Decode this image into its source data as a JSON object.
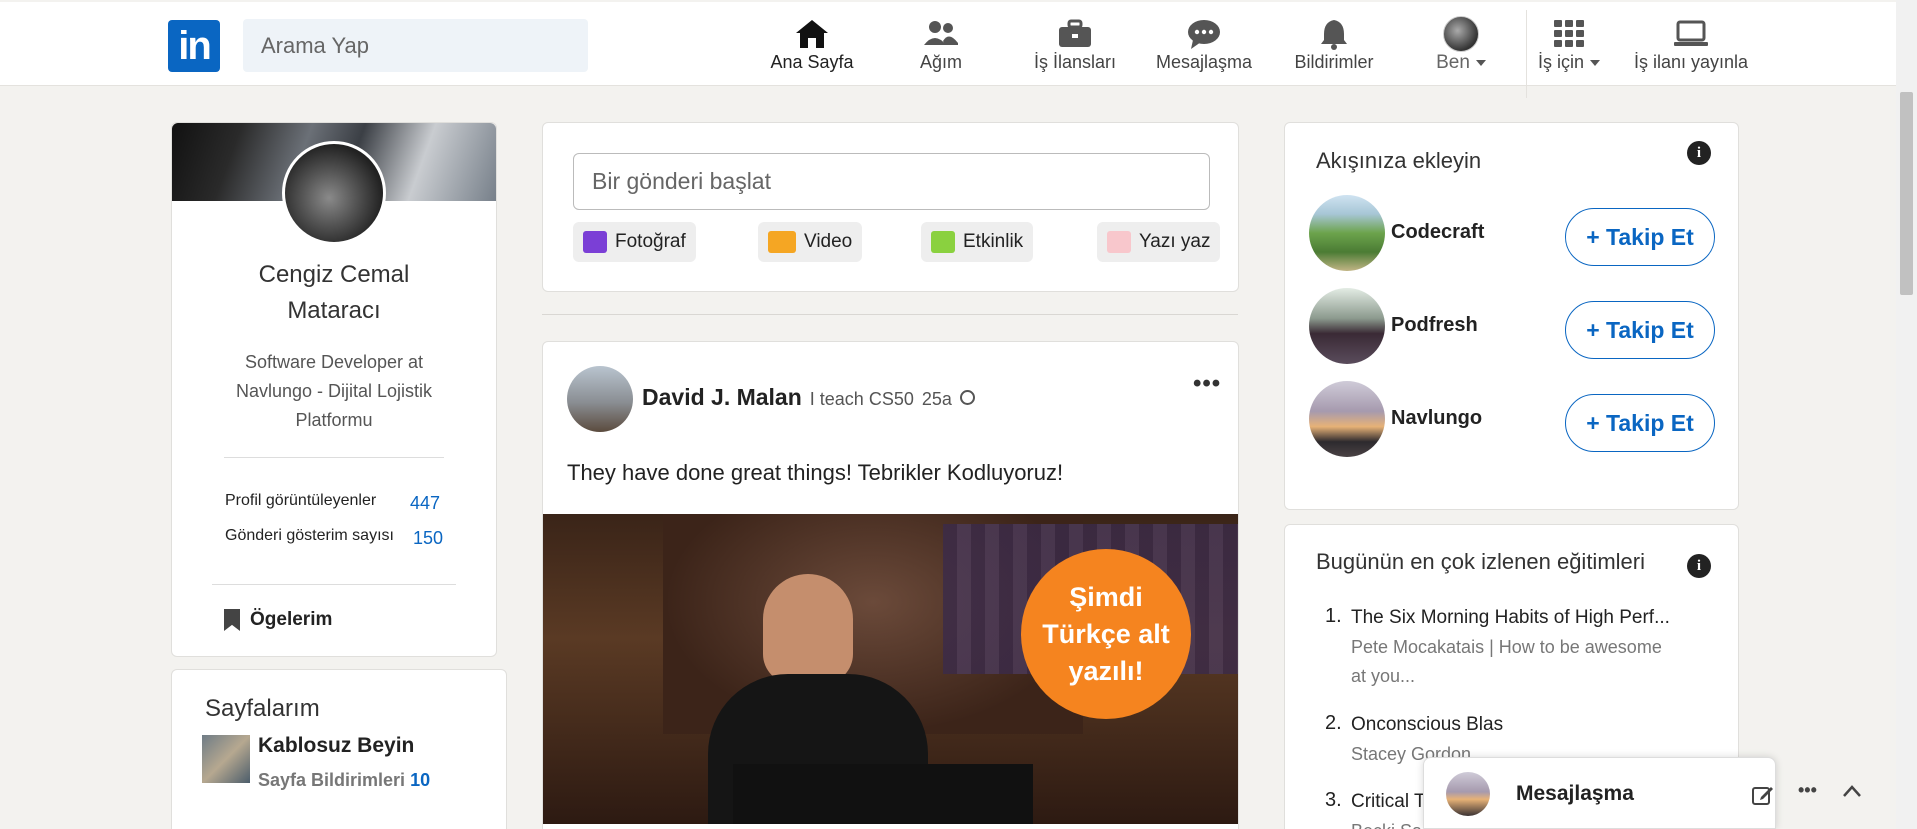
{
  "header": {
    "logo_text": "in",
    "search_placeholder": "Arama Yap",
    "nav": [
      {
        "label": "Ana Sayfa",
        "icon": "home-icon"
      },
      {
        "label": "Ağım",
        "icon": "network-icon"
      },
      {
        "label": "İş İlansları",
        "icon": "briefcase-icon"
      },
      {
        "label": "Mesajlaşma",
        "icon": "message-icon"
      },
      {
        "label": "Bildirimler",
        "icon": "bell-icon"
      },
      {
        "label": "Ben",
        "icon": "avatar"
      },
      {
        "label": "İş için",
        "icon": "grid-icon"
      },
      {
        "label": "İş ilanı yayınla",
        "icon": "laptop-icon"
      }
    ]
  },
  "profile": {
    "name": "Cengiz Cemal Mataracı",
    "title": "Software Developer at Navlungo - Dijital Lojistik Platformu",
    "views_label": "Profil görüntüleyenler",
    "views_value": "447",
    "impressions_label": "Gönderi gösterim sayısı",
    "impressions_value": "150",
    "items_label": "Ögelerim"
  },
  "pages": {
    "title": "Sayfalarım",
    "page_name": "Kablosuz Beyin",
    "notif_label": "Sayfa Bildirimleri",
    "notif_count": "10"
  },
  "composer": {
    "placeholder": "Bir gönderi başlat",
    "photo": "Fotoğraf",
    "video": "Video",
    "event": "Etkinlik",
    "article": "Yazı yaz"
  },
  "post": {
    "author": "David J. Malan",
    "headline": "I teach CS50",
    "time": "25a",
    "text": "They have done great things! Tebrikler Kodluyoruz!",
    "badge": "Şimdi Türkçe alt yazılı!"
  },
  "suggestions": {
    "title": "Akışınıza ekleyin",
    "follow_label": "+ Takip Et",
    "items": [
      "Codecraft",
      "Podfresh",
      "Navlungo"
    ]
  },
  "courses": {
    "title": "Bugünün en çok izlenen eğitimleri",
    "items": [
      {
        "n": "1.",
        "title": "The Six Morning Habits of High Perf...",
        "sub": "Pete Mocakatais | How to be awesome at you..."
      },
      {
        "n": "2.",
        "title": "Onconscious Blas",
        "sub": "Stacey Gordon"
      },
      {
        "n": "3.",
        "title": "Critical T",
        "sub": "Becki Sal"
      }
    ]
  },
  "messaging": {
    "label": "Mesajlaşma"
  },
  "colors": {
    "brand": "#0a66c2",
    "badge": "#f5841f",
    "background": "#f3f2ef"
  }
}
